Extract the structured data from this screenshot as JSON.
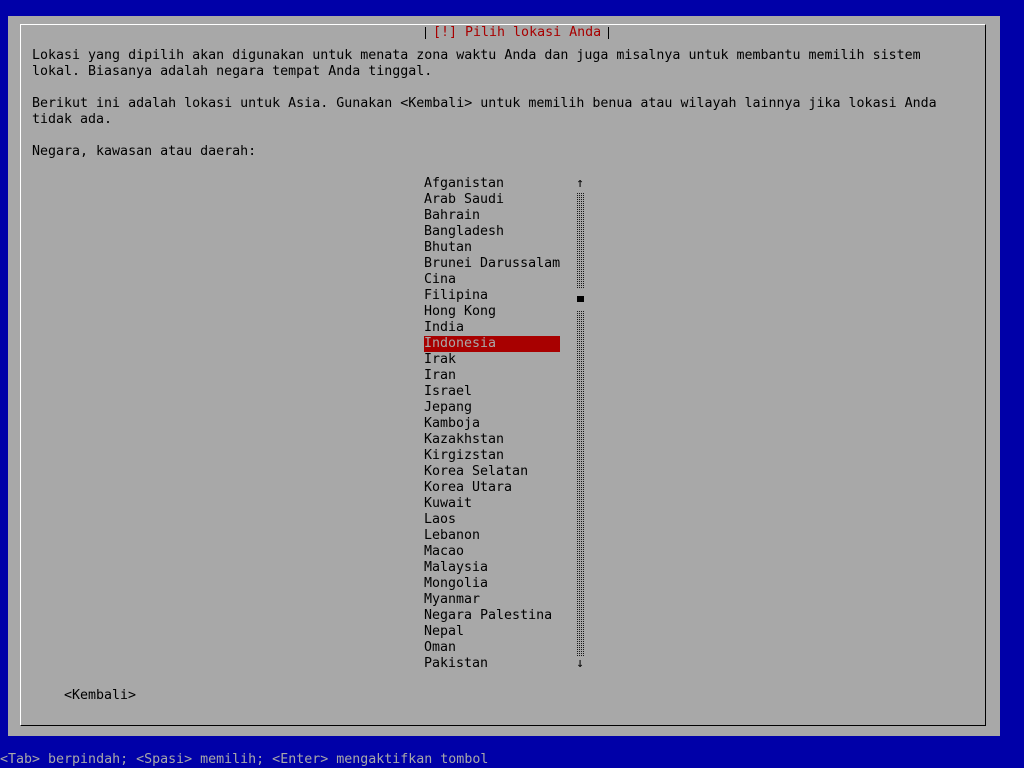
{
  "dialog": {
    "title": "[!] Pilih lokasi Anda",
    "description_lines": [
      "Lokasi yang dipilih akan digunakan untuk menata zona waktu Anda dan juga misalnya untuk membantu memilih sistem",
      "lokal. Biasanya adalah negara tempat Anda tinggal.",
      "Berikut ini adalah lokasi untuk Asia. Gunakan <Kembali> untuk memilih benua atau wilayah lainnya jika lokasi Anda",
      "tidak ada."
    ],
    "prompt": "Negara, kawasan atau daerah:",
    "back_button": "<Kembali>"
  },
  "list": {
    "items": [
      "Afganistan",
      "Arab Saudi",
      "Bahrain",
      "Bangladesh",
      "Bhutan",
      "Brunei Darussalam",
      "Cina",
      "Filipina",
      "Hong Kong",
      "India",
      "Indonesia",
      "Irak",
      "Iran",
      "Israel",
      "Jepang",
      "Kamboja",
      "Kazakhstan",
      "Kirgizstan",
      "Korea Selatan",
      "Korea Utara",
      "Kuwait",
      "Laos",
      "Lebanon",
      "Macao",
      "Malaysia",
      "Mongolia",
      "Myanmar",
      "Negara Palestina",
      "Nepal",
      "Oman",
      "Pakistan"
    ],
    "selected": "Indonesia",
    "scroll_up_icon": "↑",
    "scroll_down_icon": "↓"
  },
  "help_bar": {
    "text": "<Tab> berpindah; <Spasi> memilih; <Enter> mengaktifkan tombol"
  },
  "colors": {
    "background": "#0000a8",
    "dialog": "#a8a8a8",
    "accent": "#a80000"
  }
}
